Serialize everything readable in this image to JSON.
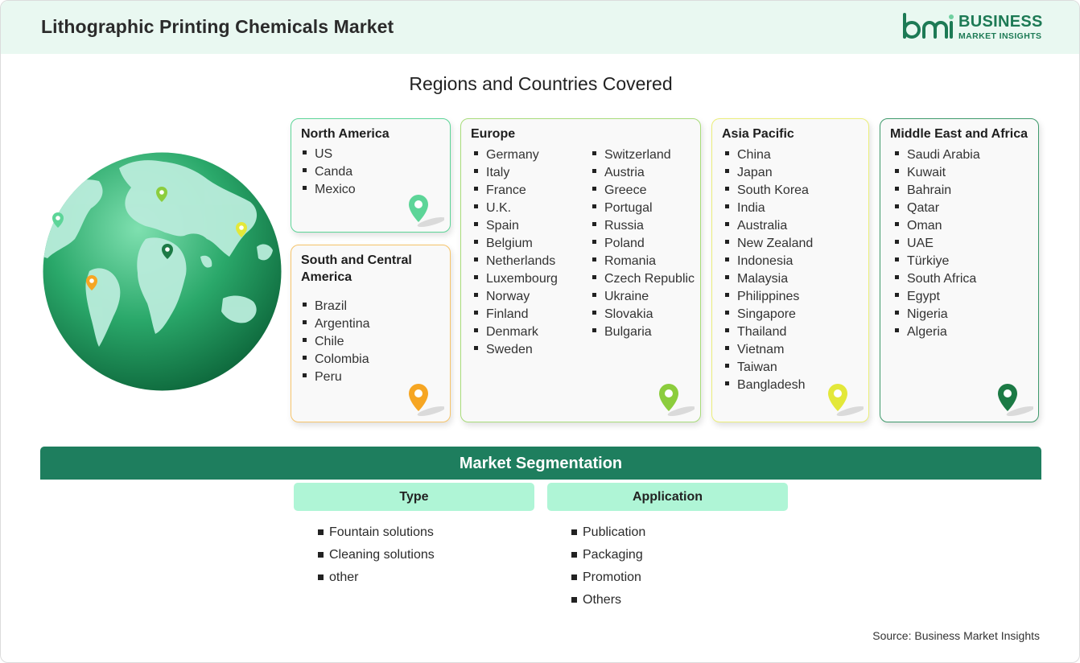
{
  "header": {
    "title": "Lithographic Printing Chemicals Market"
  },
  "logo": {
    "line1": "BUSINESS",
    "line2": "MARKET INSIGHTS",
    "mark": "bmi"
  },
  "section_title": "Regions and Countries Covered",
  "regions": [
    {
      "name": "North America",
      "color": "#5dd598",
      "items": [
        "US",
        "Canda",
        "Mexico"
      ]
    },
    {
      "name": "South and Central America",
      "color": "#f6a623",
      "items": [
        "Brazil",
        "Argentina",
        "Chile",
        "Colombia",
        "Peru"
      ]
    },
    {
      "name": "Europe",
      "color": "#8ccd3d",
      "col1": [
        "Germany",
        "Italy",
        "France",
        "U.K.",
        "Spain",
        "Belgium",
        "Netherlands",
        "Luxembourg",
        "Norway",
        "Finland",
        "Denmark",
        "Sweden"
      ],
      "col2": [
        "Switzerland",
        "Austria",
        "Greece",
        "Portugal",
        "Russia",
        "Poland",
        "Romania",
        "Czech Republic",
        "Ukraine",
        "Slovakia",
        "Bulgaria"
      ]
    },
    {
      "name": "Asia Pacific",
      "color": "#e3e83a",
      "items": [
        "China",
        "Japan",
        "South Korea",
        "India",
        "Australia",
        "New Zealand",
        "Indonesia",
        "Malaysia",
        "Philippines",
        "Singapore",
        "Thailand",
        "Vietnam",
        "Taiwan",
        "Bangladesh"
      ]
    },
    {
      "name": "Middle East and Africa",
      "color": "#1c7a45",
      "items": [
        "Saudi Arabia",
        "Kuwait",
        "Bahrain",
        "Qatar",
        "Oman",
        "UAE",
        "Türkiye",
        "South Africa",
        "Egypt",
        "Nigeria",
        "Algeria"
      ]
    }
  ],
  "segmentation": {
    "title": "Market Segmentation",
    "type": {
      "label": "Type",
      "items": [
        "Fountain solutions",
        "Cleaning solutions",
        "other"
      ]
    },
    "application": {
      "label": "Application",
      "items": [
        "Publication",
        "Packaging",
        "Promotion",
        "Others"
      ]
    }
  },
  "source": "Source: Business Market Insights",
  "colors": {
    "header_bg": "#e9f8f1",
    "brand": "#1d7a55",
    "seg_bar": "#1e7e5e",
    "seg_head": "#aff5d6"
  }
}
